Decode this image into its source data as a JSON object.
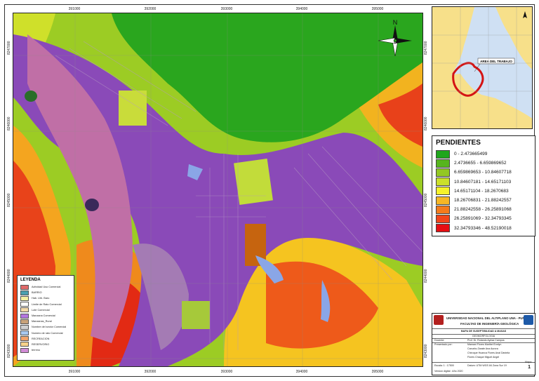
{
  "map": {
    "x_ticks": [
      "391000",
      "392000",
      "393000",
      "394000",
      "395000"
    ],
    "y_ticks": [
      "8247000",
      "8246000",
      "8245000",
      "8244000",
      "8243000"
    ],
    "north_label": "N"
  },
  "legend": {
    "title": "LEYENDA",
    "items": [
      {
        "label": "Actividad Uso Comercial",
        "color": "#e06a6a"
      },
      {
        "label": "BARRIO",
        "color": "#4aa0b0"
      },
      {
        "label": "Hab. Urb. Baru",
        "color": "#f4f0a0"
      },
      {
        "label": "Limite de Rato Comercial",
        "color": "#ffffff"
      },
      {
        "label": "Lote Comercial",
        "color": "#f3d9a8"
      },
      {
        "label": "Manzana Comercial",
        "color": "#b476e0"
      },
      {
        "label": "Manzanas_Rural",
        "color": "#c9a37a"
      },
      {
        "label": "Nombre del sector Comercial",
        "color": "#d0d0d0"
      },
      {
        "label": "Numero de rato Comercial",
        "color": "#a8c8f0"
      },
      {
        "label": "RECREACION",
        "color": "#f3a36a"
      },
      {
        "label": "RESERVORIO",
        "color": "#f6d28a"
      },
      {
        "label": "terreno",
        "color": "#d28bd6"
      }
    ]
  },
  "inset": {
    "work_area_label": "AREA DEL TRABAJO"
  },
  "pendientes": {
    "title": "PENDIENTES",
    "classes": [
      {
        "label": "0 - 2.473665499",
        "color": "#1fa61c"
      },
      {
        "label": "2.4736655 - 6.659869652",
        "color": "#57b51e"
      },
      {
        "label": "6.659869653 - 10.84607718",
        "color": "#93c823"
      },
      {
        "label": "10.84607181 - 14.65171103",
        "color": "#cbe02a"
      },
      {
        "label": "14.65171104 - 18.2670683",
        "color": "#f6f22a"
      },
      {
        "label": "18.26706831 - 21.88242557",
        "color": "#f7b725"
      },
      {
        "label": "21.88242558 - 26.25891068",
        "color": "#f47b1c"
      },
      {
        "label": "26.25891069 - 32.34793345",
        "color": "#f1451a"
      },
      {
        "label": "32.34793346 - 48.52190018",
        "color": "#e60e12"
      }
    ]
  },
  "title_block": {
    "university": "UNIVERSIDAD NACIONAL DEL ALTIPLANO UNA - PUNO",
    "faculty": "FACULTAD DE INGENIERÍA GEOLÓGICA",
    "map_title": "MAPA DE SUSEPTIBILIDAD A MASAS",
    "subject": "GEOMORFOLOGIA",
    "docente_label": "Docente:",
    "docente": "Prof. Dr. Rolando Ayesa Campos",
    "presentado_label": "Presentado por:",
    "authors": [
      "Mamani Flores Maribel Evelyn",
      "Carcahu Zarate Ana Aurora",
      "Chiroque Huanca Flores Anal Daniela",
      "Flores Chaque Miguel Angel"
    ],
    "escala": "Escala: 1 : 17500",
    "datum": "Datum: UTM WGS 84 Zona Sur 19",
    "version": "Version digital : Año 2020",
    "mapa_label": "Mapa:",
    "mapa_number": "1"
  }
}
